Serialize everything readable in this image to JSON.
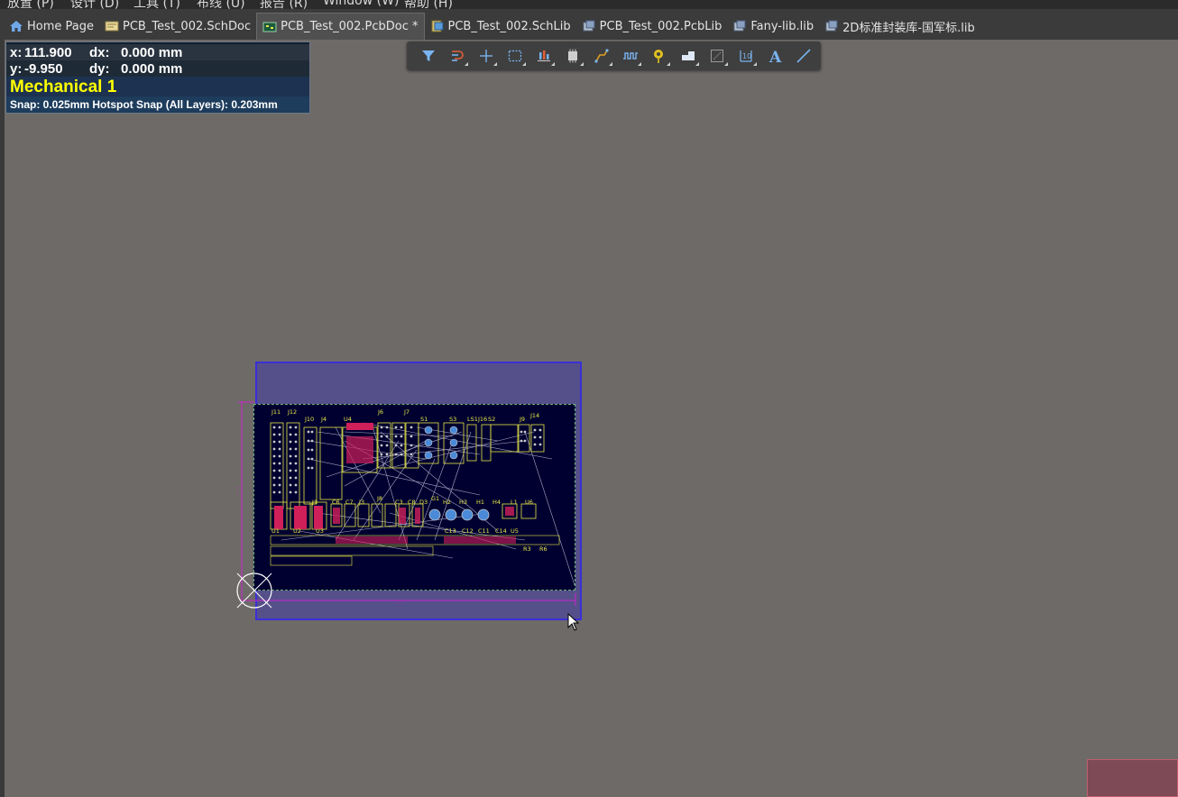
{
  "menu": {
    "items": [
      "放置 (P)",
      "设计 (D)",
      "工具 (T)",
      "布线 (U)",
      "报告 (R)",
      "Window (W)",
      "帮助 (H)"
    ]
  },
  "tabs": [
    {
      "label": "Home Page",
      "icon": "home-icon"
    },
    {
      "label": "PCB_Test_002.SchDoc",
      "icon": "schematic-doc-icon"
    },
    {
      "label": "PCB_Test_002.PcbDoc *",
      "icon": "pcb-doc-icon",
      "active": true
    },
    {
      "label": "PCB_Test_002.SchLib",
      "icon": "schlib-icon"
    },
    {
      "label": "PCB_Test_002.PcbLib",
      "icon": "pcblib-icon"
    },
    {
      "label": "Fany-lib.lib",
      "icon": "lib-icon"
    },
    {
      "label": "2D标准封装库-国军标.lib",
      "icon": "lib-icon"
    }
  ],
  "hud": {
    "x_label": "x:",
    "x_value": "111.900",
    "dx_label": "dx:",
    "dx_value": "0.000 mm",
    "y_label": "y:",
    "y_value": "-9.950",
    "dy_label": "dy:",
    "dy_value": "0.000 mm",
    "layer": "Mechanical 1",
    "snap": "Snap: 0.025mm Hotspot Snap (All Layers): 0.203mm"
  },
  "toolbar": {
    "buttons": [
      {
        "name": "filter-icon"
      },
      {
        "name": "interactive-route-icon"
      },
      {
        "name": "place-cross-icon"
      },
      {
        "name": "select-rect-icon"
      },
      {
        "name": "align-icon"
      },
      {
        "name": "component-icon"
      },
      {
        "name": "route-icon"
      },
      {
        "name": "length-tune-icon"
      },
      {
        "name": "via-icon"
      },
      {
        "name": "polygon-icon"
      },
      {
        "name": "dimension-icon"
      },
      {
        "name": "region-icon"
      },
      {
        "name": "text-icon",
        "glyph": "A"
      },
      {
        "name": "line-icon"
      }
    ]
  },
  "pcb": {
    "designators_top": [
      "J11",
      "J12",
      "J10",
      "J4",
      "U4",
      "J6",
      "J7",
      "S1",
      "S3",
      "LS1",
      "J16",
      "S2",
      "J9",
      "J14"
    ],
    "designators_mid": [
      "J1",
      "C6",
      "C7",
      "J3",
      "J8",
      "C3",
      "C8",
      "D3",
      "G1",
      "H2",
      "H3",
      "H1",
      "H4",
      "L1",
      "U6"
    ],
    "designators_low": [
      "U1",
      "U2",
      "U3",
      "C13",
      "C12",
      "C11",
      "C14",
      "U5",
      "R3",
      "R6"
    ],
    "colors": {
      "board": "#000030",
      "board_area": "#55508a",
      "silkscreen": "#e8e848",
      "ratsnest": "#c8c8e0",
      "pad": "#c8c8c8",
      "top_layer": "#d0205a",
      "keepout": "#d020d0"
    }
  }
}
